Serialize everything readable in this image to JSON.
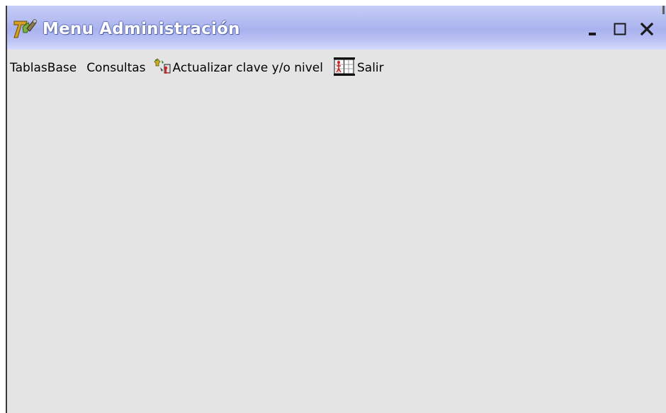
{
  "window": {
    "title": "Menu Administración",
    "app_icon": "app-logo-icon",
    "controls": {
      "minimize": "minimize-icon",
      "maximize": "maximize-icon",
      "close": "close-icon"
    }
  },
  "menubar": {
    "items": [
      {
        "label": "TablasBase",
        "icon": null
      },
      {
        "label": "Consultas",
        "icon": null
      },
      {
        "label": "Actualizar clave y/o nivel",
        "icon": "key-update-icon"
      },
      {
        "label": "Salir",
        "icon": "exit-door-icon"
      }
    ]
  },
  "colors": {
    "titlebar": "#b7bff2",
    "window_bg": "#e4e4e4",
    "title_text": "#ffffff"
  }
}
